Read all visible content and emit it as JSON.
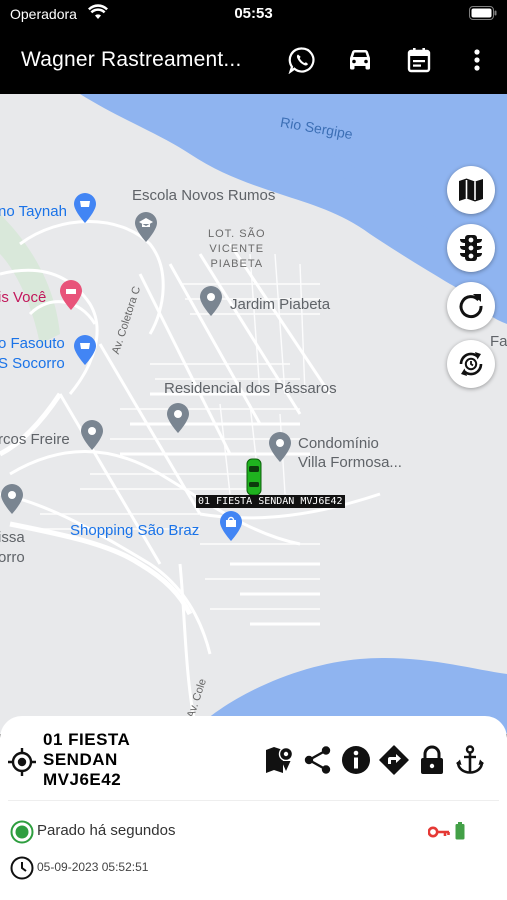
{
  "status_bar": {
    "carrier": "Operadora",
    "time": "05:53"
  },
  "app_bar": {
    "title": "Wagner Rastreament...",
    "actions": [
      "whatsapp-icon",
      "car-icon",
      "calendar-icon",
      "more-vert-icon"
    ]
  },
  "map": {
    "labels": {
      "rio": "Rio Sergipe",
      "escola": "Escola Novos Rumos",
      "taynah": "no Taynah",
      "lot": "LOT. SÃO\nVICENTE\nPIABETA",
      "jardim": "Jardim Piabeta",
      "isvoce": "is Você",
      "coletora1": "Av. Coletora C",
      "fasouto": "o Fasouto",
      "socorro": "S Socorro",
      "residencial": "Residencial dos Pássaros",
      "marcos": "rcos Freire",
      "condominio": "Condomínio\nVilla Formosa...",
      "shopping": "Shopping São Braz",
      "issa": "issa",
      "orro": "orro",
      "coletora2": "Av. Cole",
      "fa": "Fa"
    },
    "vehicle_label": "01 FIESTA SENDAN MVJ6E42",
    "fab_buttons": [
      "map-layers-icon",
      "traffic-icon",
      "refresh-icon",
      "auto-refresh-icon"
    ]
  },
  "panel": {
    "vehicle_name": "01 FIESTA\nSENDAN\nMVJ6E42",
    "actions": [
      "route-history-icon",
      "share-icon",
      "info-icon",
      "directions-icon",
      "lock-icon",
      "anchor-icon"
    ],
    "status_text": "Parado há segundos",
    "timestamp": "05-09-2023 05:52:51",
    "colors": {
      "status_green": "#2e9e3f",
      "ignition_key": "#e53935",
      "battery_green": "#43a047"
    }
  }
}
